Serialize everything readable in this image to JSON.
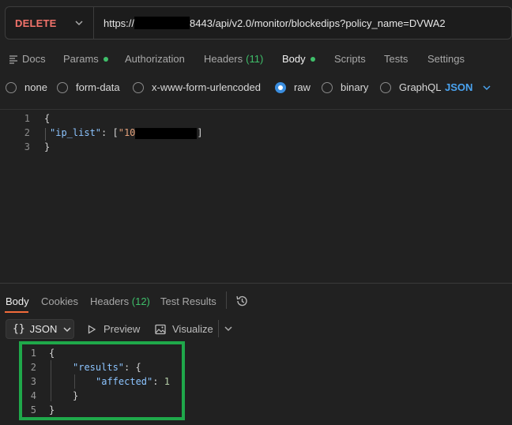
{
  "request": {
    "method": "DELETE",
    "url_prefix": "https://",
    "url_suffix": "8443/api/v2.0/monitor/blockedips?policy_name=DVWA2"
  },
  "tabs": {
    "docs": "Docs",
    "params": "Params",
    "authorization": "Authorization",
    "headers": "Headers",
    "headers_count": "(11)",
    "body": "Body",
    "scripts": "Scripts",
    "tests": "Tests",
    "settings": "Settings"
  },
  "body_types": {
    "none": "none",
    "form_data": "form-data",
    "urlencoded": "x-www-form-urlencoded",
    "raw": "raw",
    "binary": "binary",
    "graphql": "GraphQL",
    "format": "JSON",
    "selected": "raw"
  },
  "request_body": {
    "line_numbers": [
      "1",
      "2",
      "3"
    ],
    "open_brace": "{",
    "key": "\"ip_list\"",
    "colon": ": [",
    "value_prefix": "\"10",
    "close_bracket": "]",
    "close_brace": "}"
  },
  "response_tabs": {
    "body": "Body",
    "cookies": "Cookies",
    "headers": "Headers",
    "headers_count": "(12)",
    "test_results": "Test Results"
  },
  "response_toolbar": {
    "format": "JSON",
    "preview": "Preview",
    "visualize": "Visualize"
  },
  "response_body": {
    "line_numbers": [
      "1",
      "2",
      "3",
      "4",
      "5"
    ],
    "l1": "{",
    "l2_key": "\"results\"",
    "l2_rest": ": {",
    "l3_key": "\"affected\"",
    "l3_colon": ": ",
    "l3_value": "1",
    "l4": "}",
    "l5": "}"
  },
  "colors": {
    "method": "#f2736b",
    "active_dot": "#3fbf6a",
    "radio_selected": "#3a8dde",
    "highlight_box": "#1fa84a",
    "json_key": "#8cc4ff",
    "json_string": "#e3a07a"
  }
}
